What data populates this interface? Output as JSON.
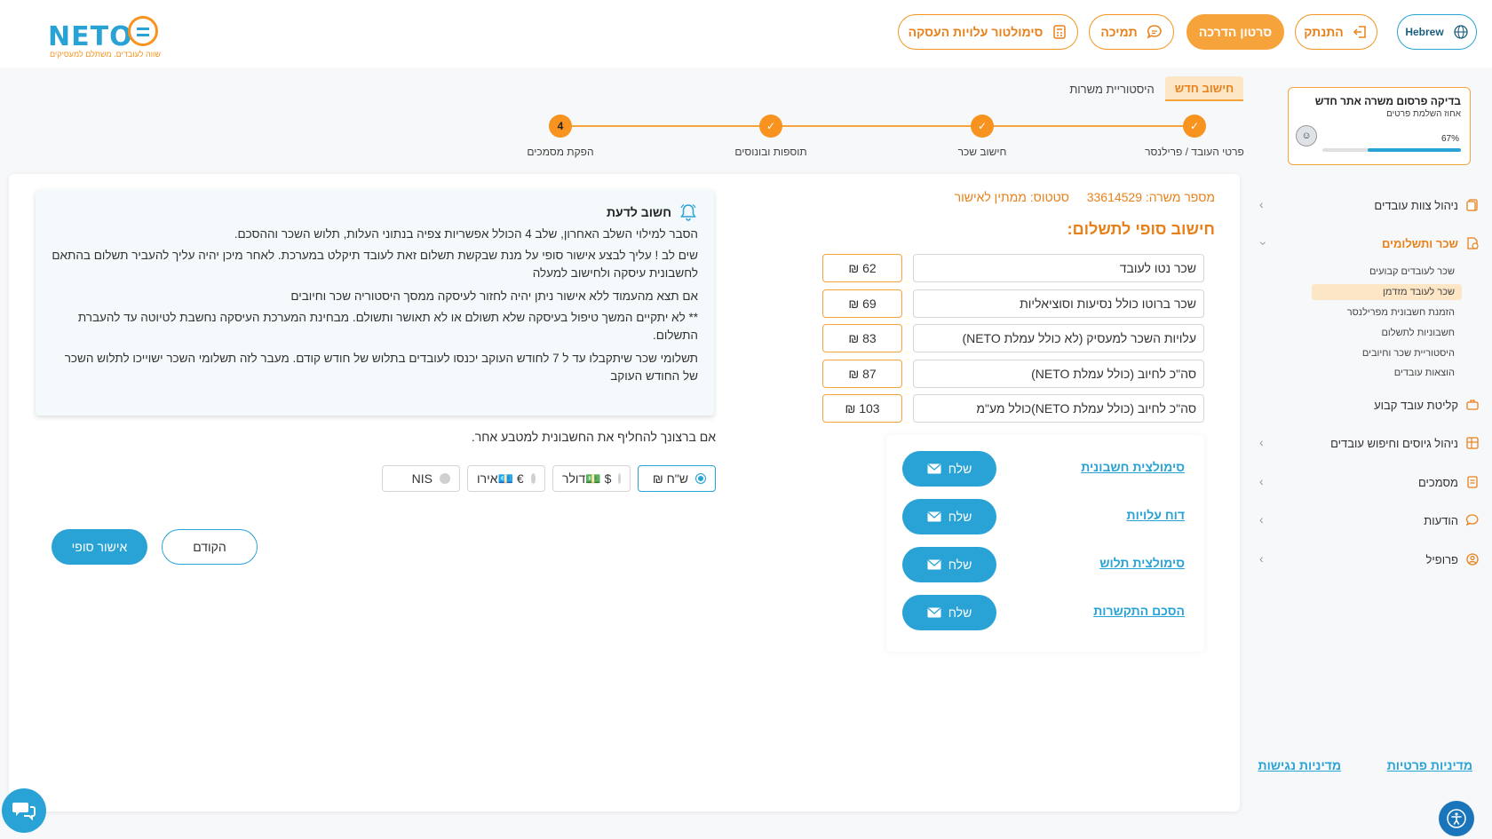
{
  "header": {
    "logo_text": "NETO",
    "logo_tagline": "שווה לעובדים. משתלם למעסיקים",
    "language_label": "Hebrew",
    "login_label": "התנתק",
    "tutorial_label": "סרטון הדרכה",
    "support_label": "תמיכה",
    "simulator_label": "סימולטור עלויות העסקה",
    "accent_color": "#f7931e",
    "primary_color": "#29a3d6"
  },
  "sidebar": {
    "progress_card": {
      "title": "בדיקה פרסום משרה אתר חדש",
      "subtitle": "אחוז השלמת פרטים",
      "percent_label": "67%",
      "percent_value": 67
    },
    "items": [
      {
        "label": "ניהול צוות עובדים"
      },
      {
        "label": "שכר ותשלומים"
      },
      {
        "label": "קליטת עובד קבוע"
      },
      {
        "label": "ניהול גיוסים וחיפוש עובדים"
      },
      {
        "label": "מסמכים"
      },
      {
        "label": "הודעות"
      },
      {
        "label": "פרופיל"
      }
    ],
    "sub_items": [
      {
        "label": "שכר לעובדים קבועים"
      },
      {
        "label": "שכר לעובד מזדמן"
      },
      {
        "label": "הזמנת חשבונית מפרילנסר"
      },
      {
        "label": "חשבוניות לתשלום"
      },
      {
        "label": "היסטוריית שכר וחיובים"
      },
      {
        "label": "הוצאות עובדים"
      }
    ],
    "footer": {
      "privacy_label": "מדיניות פרטיות",
      "accessibility_label": "מדיניות נגישות"
    }
  },
  "tabs": {
    "new_calc": "חישוב חדש",
    "history": "היסטוריית משרות"
  },
  "stepper": {
    "steps": [
      {
        "label": "פרטי העובד / פרילנסר",
        "state": "done"
      },
      {
        "label": "חישוב שכר",
        "state": "done"
      },
      {
        "label": "תוספות ובונוסים",
        "state": "done"
      },
      {
        "label": "הפקת מסמכים",
        "state": "current",
        "number": "4"
      }
    ]
  },
  "main": {
    "job_number_label": "מספר משרה:",
    "job_number": "33614529",
    "status_label": "סטטוס:",
    "status_value": "ממתין לאישור",
    "section_title": "חישוב סופי לתשלום:",
    "rows": [
      {
        "label": "שכר נטו לעובד",
        "value": "62 ₪"
      },
      {
        "label": "שכר ברוטו כולל נסיעות וסוציאליות",
        "value": "69 ₪"
      },
      {
        "label": "עלויות השכר למעסיק (לא כולל עמלת NETO)",
        "value": "83 ₪"
      },
      {
        "label": "סה\"כ לחיוב (כולל עמלת NETO)",
        "value": "87 ₪"
      },
      {
        "label": "סה\"כ לחיוב (כולל עמלת NETO)כולל מע\"מ",
        "value": "103 ₪"
      }
    ],
    "documents": [
      {
        "label": "סימולצית חשבונית",
        "button": "שלח"
      },
      {
        "label": "דוח עלויות",
        "button": "שלח"
      },
      {
        "label": "סימולצית תלוש",
        "button": "שלח"
      },
      {
        "label": "הסכם התקשרות",
        "button": "שלח"
      }
    ],
    "notice": {
      "title": "חשוב לדעת",
      "paragraphs": [
        "הסבר למילוי השלב האחרון, שלב 4 הכולל אפשריות צפיה בנתוני העלות, תלוש השכר וההסכם.",
        "שים לב ! עליך לבצע אישור סופי על מנת שבקשת תשלום זאת לעובד תיקלט במערכת. לאחר מיכן יהיה עליך להעביר תשלום בהתאם לחשבונית עיסקה ולחישוב למעלה",
        "אם תצא מהעמוד ללא אישור ניתן יהיה לחזור לעיסקה ממסך היסטוריה שכר וחיובים",
        "** לא יתקיים המשך טיפול בעיסקה שלא תשולם או לא תאושר ותשולם. מבחינת המערכת העיסקה נחשבת לטיוטה עד להעברת התשלום.",
        "תשלומי שכר שיתקבלו עד ל 7 לחודש העוקב יכנסו לעובדים בתלוש של חודש קודם. מעבר לזה תשלומי השכר ישוייכו לתלוש השכר של החודש העוקב"
      ]
    },
    "currency_prompt": "אם ברצונך להחליף את החשבונית למטבע אחר.",
    "currencies": [
      {
        "label": "ש\"ח ₪",
        "selected": true
      },
      {
        "label": "$ 💵דולר",
        "selected": false
      },
      {
        "label": "€ 💶אירו",
        "selected": false
      },
      {
        "label": "NIS",
        "selected": false
      }
    ],
    "prev_label": "הקודם",
    "final_label": "אישור סופי"
  }
}
